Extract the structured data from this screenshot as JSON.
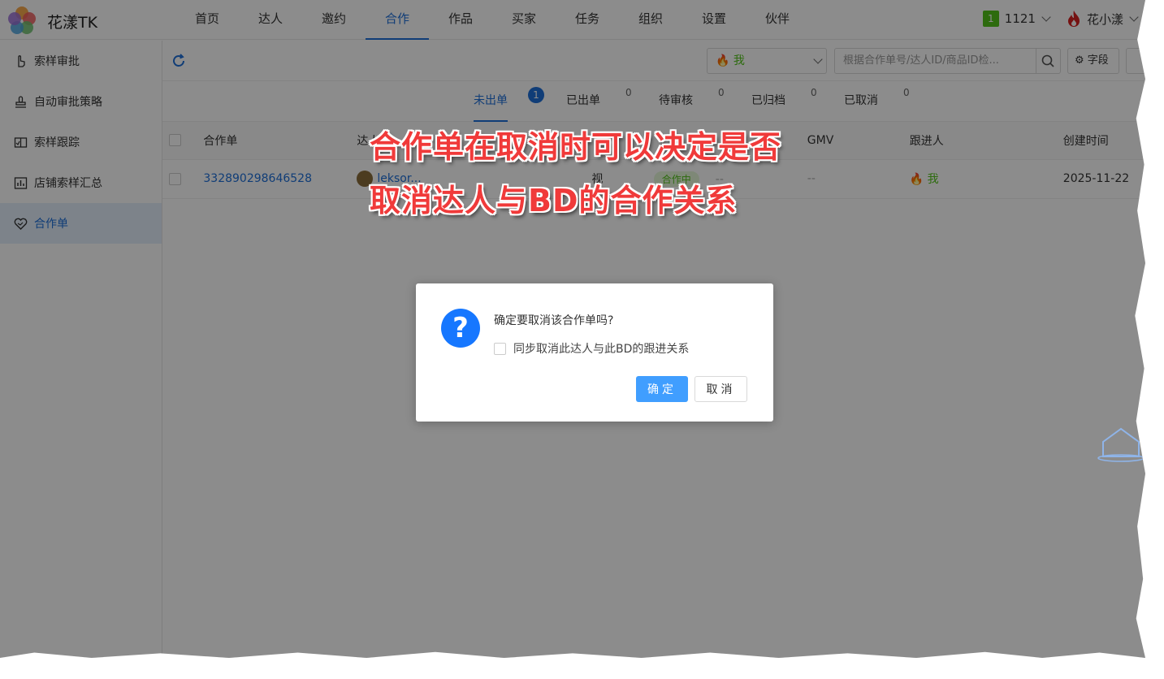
{
  "app": {
    "name": "花漾TK"
  },
  "nav": {
    "items": [
      "首页",
      "达人",
      "邀约",
      "合作",
      "作品",
      "买家",
      "任务",
      "组织",
      "设置",
      "伙伴"
    ],
    "active_index": 3
  },
  "header": {
    "badge": "1",
    "count": "1121",
    "user": "花小漾"
  },
  "sidebar": {
    "items": [
      {
        "label": "索样审批",
        "icon": "hand-pointer-icon"
      },
      {
        "label": "自动审批策略",
        "icon": "stamp-icon"
      },
      {
        "label": "索样跟踪",
        "icon": "tracking-icon"
      },
      {
        "label": "店铺索样汇总",
        "icon": "bar-chart-icon"
      },
      {
        "label": "合作单",
        "icon": "handshake-heart-icon"
      }
    ],
    "active_index": 4
  },
  "toolbar": {
    "owner": "我",
    "search_placeholder": "根据合作单号/达人ID/商品ID检...",
    "fields_label": "字段"
  },
  "tabs": [
    {
      "label": "未出单",
      "count": "1"
    },
    {
      "label": "已出单",
      "count": "0"
    },
    {
      "label": "待审核",
      "count": "0"
    },
    {
      "label": "已归档",
      "count": "0"
    },
    {
      "label": "已取消",
      "count": "0"
    }
  ],
  "table": {
    "headers": [
      "合作单",
      "达人ID",
      "",
      "",
      "GMV",
      "跟进人",
      "创建时间"
    ],
    "row": {
      "order_id": "332890298646528",
      "creator": "leksor...",
      "col3": "视",
      "status": "合作中",
      "dash1": "--",
      "gmv": "--",
      "follower": "我",
      "created": "2025-11-22"
    }
  },
  "annotation": {
    "line1": "合作单在取消时可以决定是否",
    "line2": "取消达人与BD的合作关系"
  },
  "dialog": {
    "title": "确定要取消该合作单吗?",
    "checkbox_label": "同步取消此达人与此BD的跟进关系",
    "ok": "确定",
    "cancel": "取消"
  }
}
